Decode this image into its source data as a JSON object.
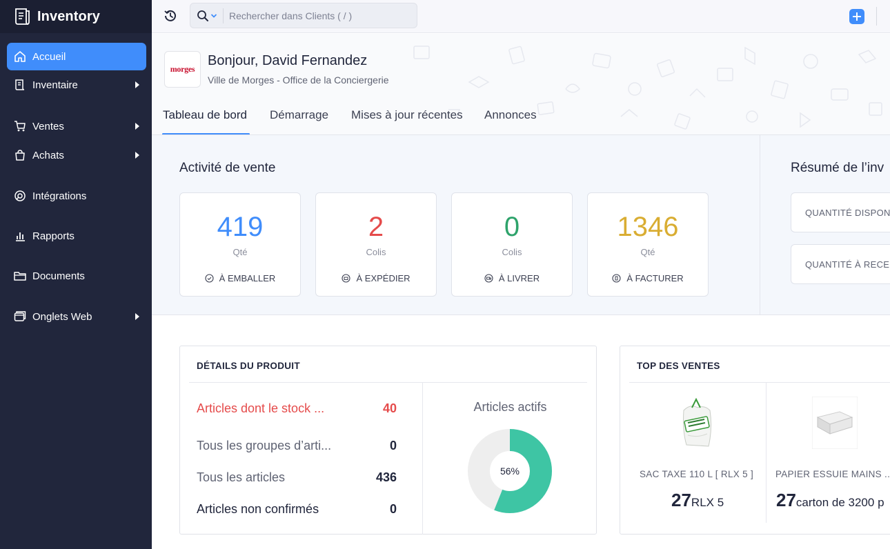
{
  "app": {
    "name": "Inventory"
  },
  "sidebar": {
    "items": [
      {
        "label": "Accueil",
        "icon": "home-icon",
        "active": true,
        "has_arrow": false
      },
      {
        "label": "Inventaire",
        "icon": "inventory-icon",
        "active": false,
        "has_arrow": true
      },
      {
        "label": "Ventes",
        "icon": "cart-icon",
        "active": false,
        "has_arrow": true
      },
      {
        "label": "Achats",
        "icon": "bag-icon",
        "active": false,
        "has_arrow": true
      },
      {
        "label": "Intégrations",
        "icon": "integrations-icon",
        "active": false,
        "has_arrow": false
      },
      {
        "label": "Rapports",
        "icon": "reports-icon",
        "active": false,
        "has_arrow": false
      },
      {
        "label": "Documents",
        "icon": "folder-icon",
        "active": false,
        "has_arrow": false
      },
      {
        "label": "Onglets Web",
        "icon": "web-tabs-icon",
        "active": false,
        "has_arrow": true
      }
    ]
  },
  "topbar": {
    "search_placeholder": "Rechercher dans Clients ( / )"
  },
  "header": {
    "logo_text": "morges",
    "greeting": "Bonjour, David Fernandez",
    "organization": "Ville de Morges - Office de la Conciergerie",
    "tabs": [
      {
        "label": "Tableau de bord",
        "active": true
      },
      {
        "label": "Démarrage",
        "active": false
      },
      {
        "label": "Mises à jour récentes",
        "active": false
      },
      {
        "label": "Annonces",
        "active": false
      }
    ]
  },
  "sales_activity": {
    "title": "Activité de vente",
    "cards": [
      {
        "value": "419",
        "unit": "Qté",
        "label": "À EMBALLER",
        "color": "#408dfb",
        "icon": "check-circle-icon"
      },
      {
        "value": "2",
        "unit": "Colis",
        "label": "À EXPÉDIER",
        "color": "#e54b4b",
        "icon": "ship-circle-icon"
      },
      {
        "value": "0",
        "unit": "Colis",
        "label": "À LIVRER",
        "color": "#2ea36b",
        "icon": "truck-circle-icon"
      },
      {
        "value": "1346",
        "unit": "Qté",
        "label": "À FACTURER",
        "color": "#d9ad32",
        "icon": "invoice-circle-icon"
      }
    ]
  },
  "inventory_summary": {
    "title": "Résumé de l’inv",
    "items": [
      "QUANTITÉ DISPON",
      "QUANTITÉ À RECE"
    ]
  },
  "product_details": {
    "title": "DÉTAILS DU PRODUIT",
    "rows": [
      {
        "label": "Articles dont le stock ...",
        "value": "40"
      },
      {
        "label": "Tous les groupes d’arti...",
        "value": "0"
      },
      {
        "label": "Tous les articles",
        "value": "436"
      },
      {
        "label": "Articles non confirmés",
        "value": "0"
      }
    ],
    "chart": {
      "title": "Articles actifs",
      "percent_label": "56%",
      "fraction": 0.56,
      "fill_color": "#3ec5a4",
      "track_color": "#eeeeee"
    }
  },
  "top_sales": {
    "title": "TOP DES VENTES",
    "items": [
      {
        "name": "SAC TAXE 110 L [ RLX 5 ]",
        "qty": "27",
        "unit": "RLX 5",
        "image": "trash-bag-image"
      },
      {
        "name": "PAPIER ESSUIE MAINS ...",
        "qty": "27",
        "unit": "carton de 3200 p",
        "image": "paper-towel-image"
      }
    ]
  },
  "colors": {
    "sidebar_bg": "#21263c",
    "accent": "#408dfb",
    "danger": "#e54b4b",
    "success": "#2ea36b",
    "warning": "#d9ad32"
  }
}
